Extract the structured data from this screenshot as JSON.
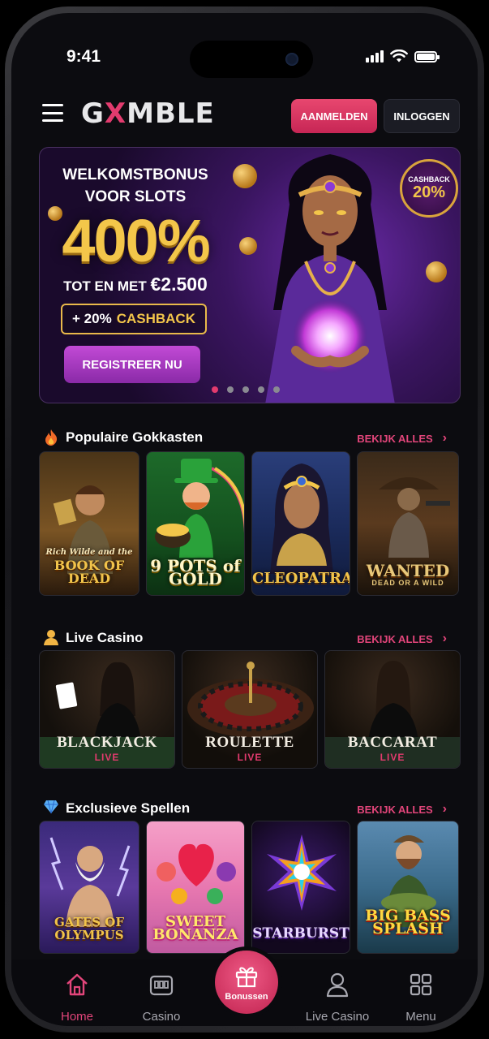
{
  "status_bar": {
    "time": "9:41"
  },
  "header": {
    "logo": {
      "part1": "G",
      "part2": "X",
      "part3": "MBLE"
    },
    "register_label": "AANMELDEN",
    "login_label": "INLOGGEN"
  },
  "hero": {
    "title_line1": "WELKOMSTBONUS",
    "title_line2": "VOOR SLOTS",
    "percentage": "400%",
    "upto_prefix": "TOT EN MET",
    "upto_amount": "€2.500",
    "cashback_prefix": "+ 20%",
    "cashback_word": "CASHBACK",
    "cta_label": "REGISTREER NU",
    "badge_label": "CASHBACK",
    "badge_value": "20%",
    "slide_count": 5,
    "active_slide": 1
  },
  "sections": {
    "popular": {
      "title": "Populaire Gokkasten",
      "view_all": "BEKIJK ALLES",
      "games": [
        {
          "title": "BOOK OF DEAD",
          "subtitle": "Rich Wilde and the"
        },
        {
          "title": "9 POTS of GOLD"
        },
        {
          "title": "CLEOPATRA"
        },
        {
          "title": "WANTED",
          "subtitle": "DEAD OR A WILD"
        }
      ]
    },
    "live": {
      "title": "Live Casino",
      "view_all": "BEKIJK ALLES",
      "tables": [
        {
          "name": "BLACKJACK",
          "tag": "LIVE"
        },
        {
          "name": "ROULETTE",
          "tag": "LIVE"
        },
        {
          "name": "BACCARAT",
          "tag": "LIVE"
        }
      ]
    },
    "exclusive": {
      "title": "Exclusieve Spellen",
      "view_all": "BEKIJK ALLES",
      "games": [
        {
          "title": "GATES OF OLYMPUS"
        },
        {
          "title": "SWEET BONANZA"
        },
        {
          "title": "STARBURST"
        },
        {
          "title": "BIG BASS SPLASH"
        }
      ]
    }
  },
  "tabbar": {
    "home": "Home",
    "casino": "Casino",
    "bonus": "Bonussen",
    "live": "Live Casino",
    "menu": "Menu"
  },
  "colors": {
    "accent": "#e2457a",
    "gold": "#f3c64a",
    "background": "#0c0c10"
  }
}
